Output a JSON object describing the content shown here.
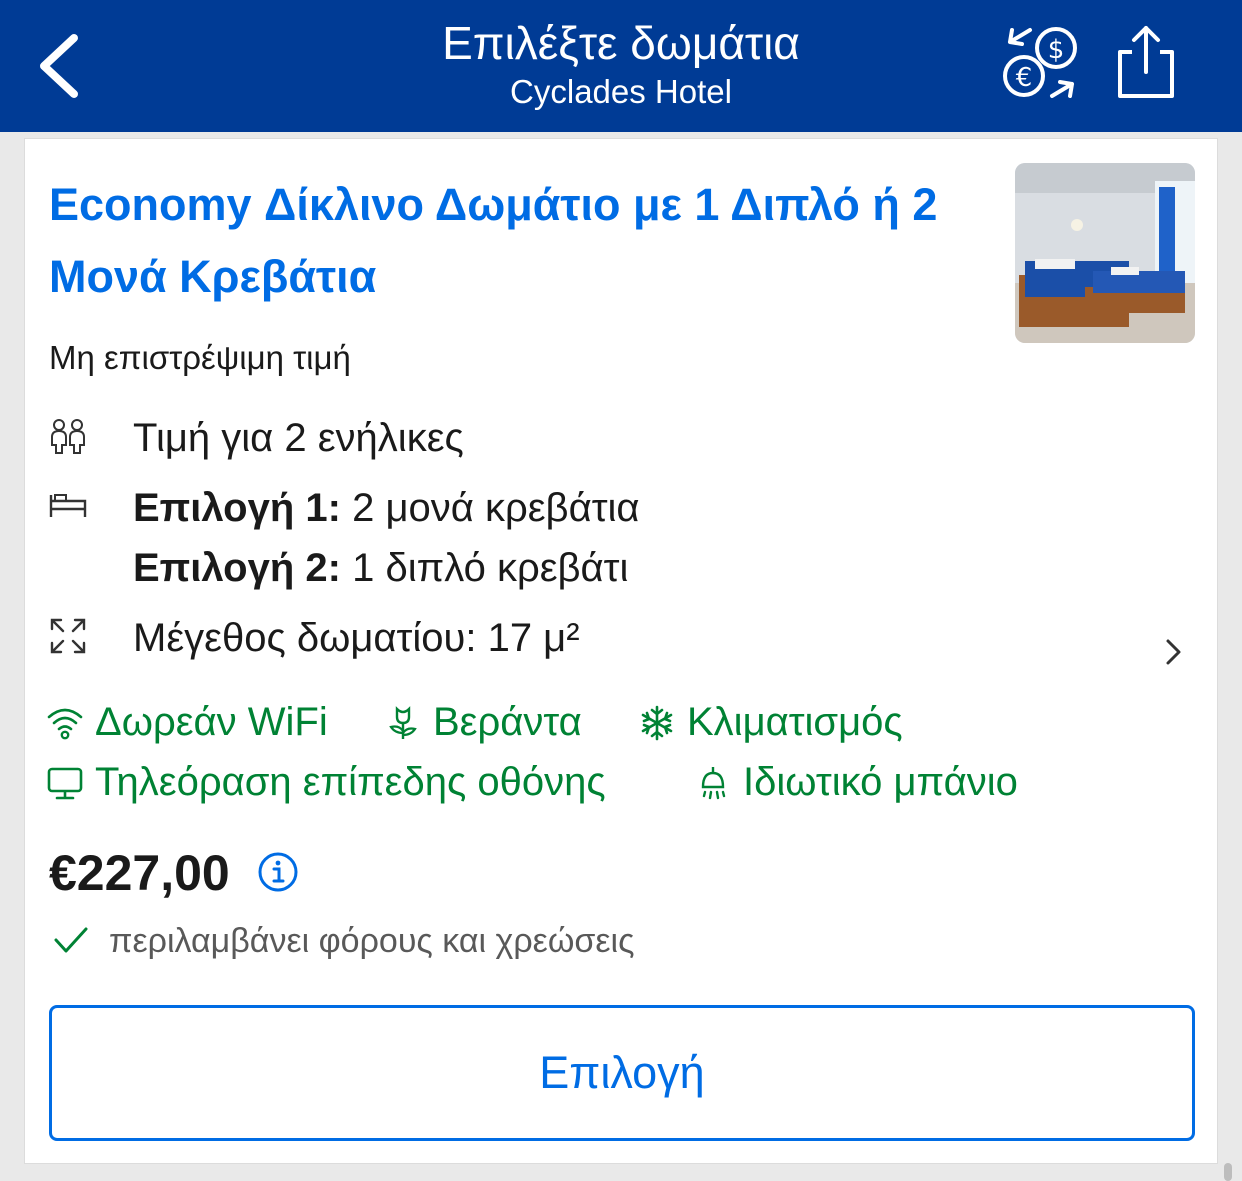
{
  "header": {
    "title": "Επιλέξτε δωμάτια",
    "subtitle": "Cyclades Hotel",
    "back_icon": "chevron-left-icon",
    "currency_icon": "currency-exchange-icon",
    "share_icon": "share-icon",
    "background": "#003b95"
  },
  "room": {
    "title": "Economy Δίκλινο Δωμάτιο με 1 Διπλό ή 2 Μονά Κρεβάτια",
    "policy": "Μη επιστρέψιμη τιμή",
    "occupancy": "Τιμή για 2 ενήλικες",
    "bed_option_1_label": "Επιλογή 1:",
    "bed_option_1_value": " 2 μονά κρεβάτια",
    "bed_option_2_label": "Επιλογή 2:",
    "bed_option_2_value": " 1 διπλό κρεβάτι",
    "size": "Μέγεθος δωματίου: 17 μ²",
    "facilities": [
      {
        "label": "Δωρεάν WiFi",
        "icon": "wifi-icon"
      },
      {
        "label": "Βεράντα",
        "icon": "flower-icon"
      },
      {
        "label": "Κλιματισμός",
        "icon": "snowflake-icon"
      },
      {
        "label": "Τηλεόραση επίπεδης οθόνης",
        "icon": "tv-icon"
      },
      {
        "label": "Ιδιωτικό μπάνιο",
        "icon": "shower-icon"
      }
    ],
    "price": "€227,00",
    "tax_note": "περιλαμβάνει φόρους και χρεώσεις",
    "select_label": "Επιλογή"
  },
  "colors": {
    "title_blue": "#006ce4",
    "facility_green": "#008234"
  }
}
